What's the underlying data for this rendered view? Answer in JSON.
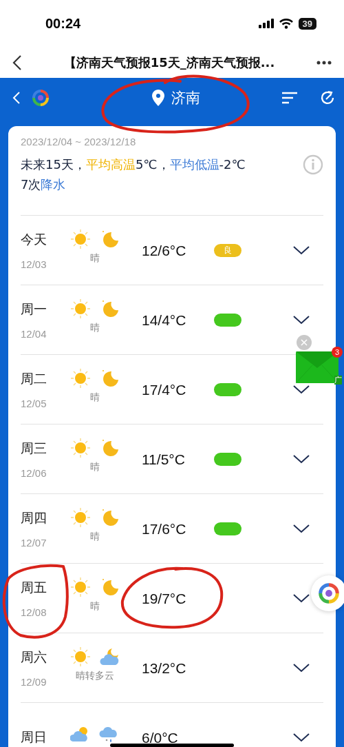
{
  "status_bar": {
    "time": "00:24",
    "battery": "39"
  },
  "browser": {
    "title": "【济南天气预报15天_济南天气预报..."
  },
  "header": {
    "city": "济南"
  },
  "summary": {
    "date_range": "2023/12/04 ~ 2023/12/18",
    "segments": [
      {
        "kind": "plain",
        "text": "未来15天，"
      },
      {
        "kind": "high",
        "text": "平均高温"
      },
      {
        "kind": "plain",
        "text": "5℃，"
      },
      {
        "kind": "low",
        "text": "平均低温"
      },
      {
        "kind": "plain",
        "text": "-2℃"
      },
      {
        "kind": "plain",
        "text": "7次"
      },
      {
        "kind": "low",
        "text": "降水"
      }
    ]
  },
  "days": [
    {
      "day": "今天",
      "date": "12/03",
      "icons": [
        {
          "kind": "sun"
        },
        {
          "kind": "moon"
        }
      ],
      "condition": "晴",
      "temp": "12/6°C",
      "aqi": {
        "label": "良",
        "color": "#ecbf1c"
      }
    },
    {
      "day": "周一",
      "date": "12/04",
      "icons": [
        {
          "kind": "sun"
        },
        {
          "kind": "moon"
        }
      ],
      "condition": "晴",
      "temp": "14/4°C",
      "aqi": {
        "color": "#45c81e"
      }
    },
    {
      "day": "周二",
      "date": "12/05",
      "icons": [
        {
          "kind": "sun"
        },
        {
          "kind": "moon"
        }
      ],
      "condition": "晴",
      "temp": "17/4°C",
      "aqi": {
        "color": "#45c81e"
      }
    },
    {
      "day": "周三",
      "date": "12/06",
      "icons": [
        {
          "kind": "sun"
        },
        {
          "kind": "moon"
        }
      ],
      "condition": "晴",
      "temp": "11/5°C",
      "aqi": {
        "color": "#45c81e"
      }
    },
    {
      "day": "周四",
      "date": "12/07",
      "icons": [
        {
          "kind": "sun"
        },
        {
          "kind": "moon"
        }
      ],
      "condition": "晴",
      "temp": "17/6°C",
      "aqi": {
        "color": "#45c81e"
      }
    },
    {
      "day": "周五",
      "date": "12/08",
      "icons": [
        {
          "kind": "sun"
        },
        {
          "kind": "moon"
        }
      ],
      "condition": "晴",
      "temp": "19/7°C"
    },
    {
      "day": "周六",
      "date": "12/09",
      "icons": [
        {
          "kind": "sun"
        },
        {
          "kind": "cloud-moon"
        }
      ],
      "condition": "晴转多云",
      "temp": "13/2°C"
    },
    {
      "day": "周日",
      "icons": [
        {
          "kind": "sun-cloud"
        },
        {
          "kind": "rain-snow"
        }
      ],
      "temp": "6/0°C"
    }
  ],
  "ad": {
    "badge": "3",
    "label": "广"
  },
  "annotations": [
    {
      "kind": "circle"
    },
    {
      "kind": "circle"
    },
    {
      "kind": "circle"
    }
  ]
}
